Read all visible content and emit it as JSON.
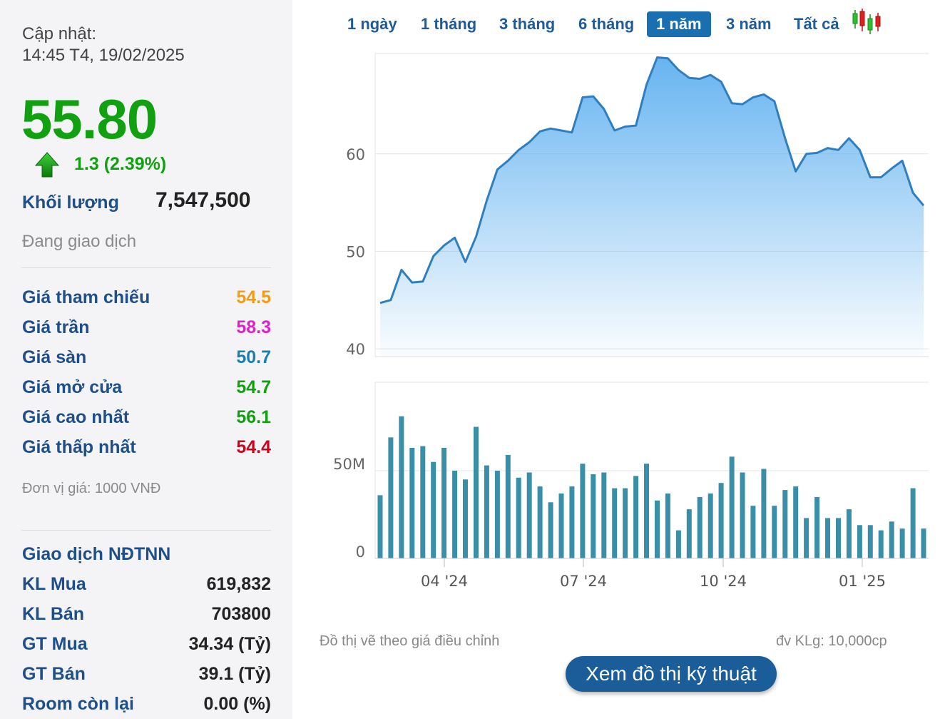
{
  "update": {
    "label": "Cập nhật:",
    "datetime": "14:45 T4, 19/02/2025"
  },
  "price": {
    "current": "55.80",
    "change": "1.3 (2.39%)",
    "color": "#10a010"
  },
  "volume": {
    "label": "Khối lượng",
    "value": "7,547,500"
  },
  "status": "Đang giao dịch",
  "prices": [
    {
      "label": "Giá tham chiếu",
      "value": "54.5",
      "color": "#f39c12"
    },
    {
      "label": "Giá trần",
      "value": "58.3",
      "color": "#e020c8"
    },
    {
      "label": "Giá sàn",
      "value": "50.7",
      "color": "#1a7fb0"
    },
    {
      "label": "Giá mở cửa",
      "value": "54.7",
      "color": "#10a010"
    },
    {
      "label": "Giá cao nhất",
      "value": "56.1",
      "color": "#10a010"
    },
    {
      "label": "Giá thấp nhất",
      "value": "54.4",
      "color": "#d0021b"
    }
  ],
  "unit_note": "Đơn vị giá: 1000 VNĐ",
  "foreign": {
    "title": "Giao dịch NĐTNN",
    "rows": [
      {
        "label": "KL Mua",
        "value": "619,832"
      },
      {
        "label": "KL Bán",
        "value": "703800"
      },
      {
        "label": "GT Mua",
        "value": "34.34 (Tỷ)"
      },
      {
        "label": "GT Bán",
        "value": "39.1 (Tỷ)"
      },
      {
        "label": "Room còn lại",
        "value": "0.00 (%)"
      }
    ]
  },
  "tabs": [
    {
      "label": "1 ngày",
      "active": false
    },
    {
      "label": "1 tháng",
      "active": false
    },
    {
      "label": "3 tháng",
      "active": false
    },
    {
      "label": "6 tháng",
      "active": false
    },
    {
      "label": "1 năm",
      "active": true
    },
    {
      "label": "3 năm",
      "active": false
    },
    {
      "label": "Tất cả",
      "active": false
    }
  ],
  "notes": {
    "adjusted": "Đồ thị vẽ theo giá điều chỉnh",
    "vol_unit": "đv KLg: 10,000cp"
  },
  "tech_button": "Xem đồ thị kỹ thuật",
  "colors": {
    "accent": "#1a6fb0",
    "line": "#2f7fc0",
    "bar": "#3a8fa8"
  },
  "chart_data": {
    "type": "area",
    "price_axis": {
      "ticks": [
        "60",
        "50",
        "40"
      ],
      "ylim": [
        39.2,
        70.3
      ]
    },
    "volume_axis": {
      "ticks": [
        "50M",
        "0"
      ],
      "ylim": [
        0,
        100
      ]
    },
    "x_ticks": [
      "04 '24",
      "07 '24",
      "10 '24",
      "01 '25"
    ],
    "price": [
      44.7,
      45.0,
      48.1,
      46.8,
      46.9,
      49.5,
      50.6,
      51.4,
      48.9,
      51.5,
      55.2,
      58.4,
      59.3,
      60.4,
      61.2,
      62.3,
      62.6,
      62.4,
      62.2,
      65.8,
      65.9,
      64.6,
      62.4,
      62.8,
      62.9,
      67.1,
      69.9,
      69.8,
      68.6,
      67.8,
      67.7,
      68.1,
      67.4,
      65.2,
      65.1,
      65.8,
      66.1,
      65.4,
      61.6,
      58.2,
      60.0,
      60.1,
      60.6,
      60.4,
      61.6,
      60.4,
      57.6,
      57.6,
      58.5,
      59.3,
      56.0,
      54.7
    ],
    "volume": [
      36,
      69,
      81,
      63,
      64,
      55,
      63,
      50,
      45,
      75,
      53,
      50,
      59,
      46,
      49,
      41,
      32,
      37,
      41,
      54,
      48,
      49,
      40,
      40,
      47,
      54,
      33,
      37,
      16,
      28,
      35,
      37,
      43,
      58,
      49,
      30,
      51,
      30,
      39,
      41,
      23,
      35,
      23,
      23,
      28,
      19,
      19,
      16,
      21,
      17,
      40,
      17
    ]
  }
}
